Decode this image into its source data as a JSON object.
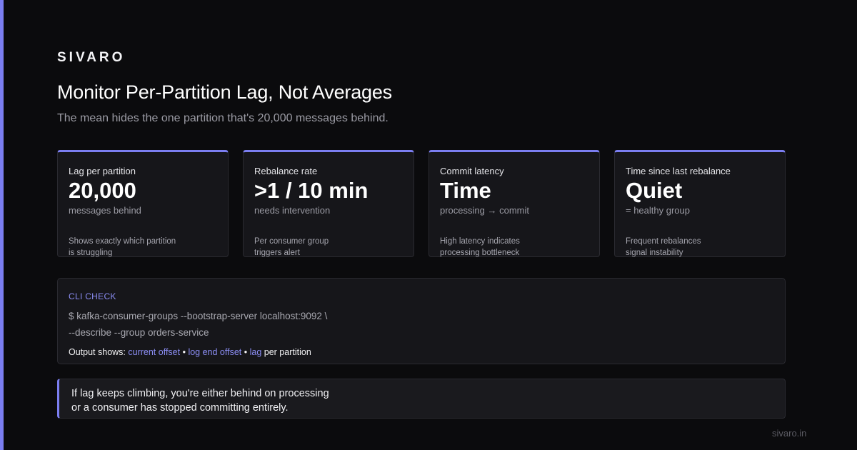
{
  "brand": "SIVARO",
  "title": "Monitor Per-Partition Lag, Not Averages",
  "subtitle": "The mean hides the one partition that's 20,000 messages behind.",
  "cards": [
    {
      "label": "Lag per partition",
      "value": "20,000",
      "unit": "messages behind",
      "note_line1": "Shows exactly which partition",
      "note_line2": "is struggling"
    },
    {
      "label": "Rebalance rate",
      "value": ">1 / 10 min",
      "unit": "needs intervention",
      "note_line1": "Per consumer group",
      "note_line2": "triggers alert"
    },
    {
      "label": "Commit latency",
      "value": "Time",
      "unit": "processing → commit",
      "note_line1": "High latency indicates",
      "note_line2": "processing bottleneck"
    },
    {
      "label": "Time since last rebalance",
      "value": "Quiet",
      "unit": "= healthy group",
      "note_line1": "Frequent rebalances",
      "note_line2": "signal instability"
    }
  ],
  "cli": {
    "label": "CLI CHECK",
    "cmd_line1": "$ kafka-consumer-groups --bootstrap-server localhost:9092 \\",
    "cmd_line2": "--describe --group orders-service",
    "output_prefix": "Output shows: ",
    "output_hl1": "current offset",
    "output_sep1": " • ",
    "output_hl2": "log end offset",
    "output_sep2": " • ",
    "output_hl3": "lag",
    "output_suffix": " per partition"
  },
  "callout": {
    "line1": "If lag keeps climbing, you're either behind on processing",
    "line2": "or a consumer has stopped committing entirely."
  },
  "footer": "sivaro.in",
  "colors": {
    "accent": "#7b7ef0",
    "background": "#0b0b0d",
    "card": "#16161a"
  }
}
